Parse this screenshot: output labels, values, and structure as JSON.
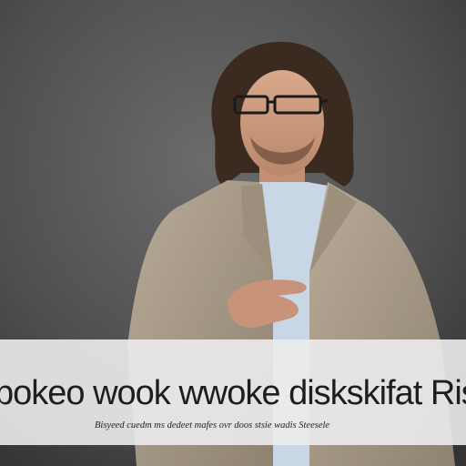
{
  "image": {
    "subject": "man with glasses and curly hair in beige blazer gesturing",
    "colors": {
      "background": "#4a4a4a",
      "blazer": "#a89a88",
      "shirt": "#c8d6e6",
      "banner": "#ececec",
      "text": "#1e1e1e"
    }
  },
  "banner": {
    "headline": "pokeo wook wwoke diskskifat Ris",
    "caption": "Bisyeed cuedm ms dedeet mafes ovr doos stsie wadis Steesele"
  }
}
